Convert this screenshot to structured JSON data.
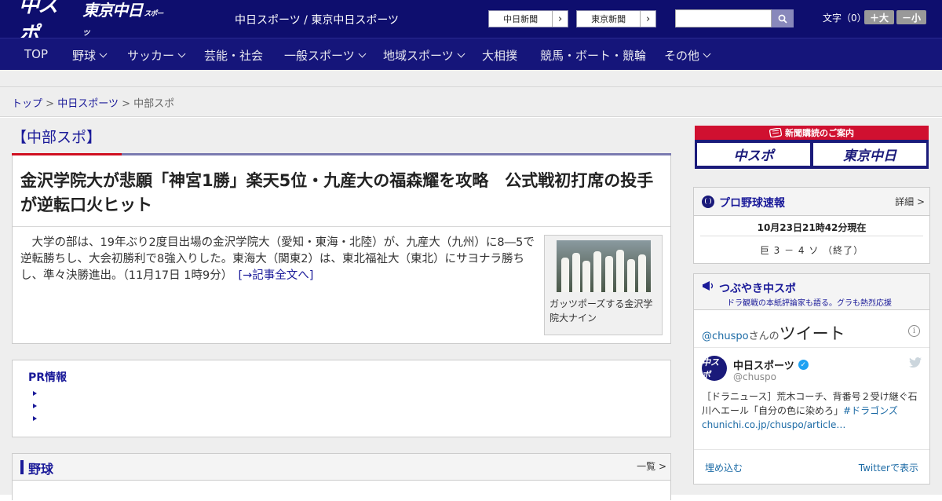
{
  "header": {
    "logo_primary": "中スポ",
    "logo_secondary": "東京中日",
    "logo_secondary_small": "スポーツ",
    "site_title": "中日スポーツ / 東京中日スポーツ",
    "newspaper_links": [
      {
        "label": "中日新聞",
        "arrow": "›"
      },
      {
        "label": "東京新聞",
        "arrow": "›"
      }
    ],
    "search": {
      "placeholder": "",
      "icon": "search-icon"
    },
    "font_size": {
      "label": "文字（0）",
      "increase": "＋大",
      "decrease": "－小"
    }
  },
  "nav": {
    "items": [
      {
        "label": "TOP",
        "dropdown": false
      },
      {
        "label": "野球",
        "dropdown": true
      },
      {
        "label": "サッカー",
        "dropdown": true
      },
      {
        "label": "芸能・社会",
        "dropdown": false
      },
      {
        "label": "一般スポーツ",
        "dropdown": true
      },
      {
        "label": "地域スポーツ",
        "dropdown": true
      },
      {
        "label": "大相撲",
        "dropdown": false
      },
      {
        "label": "競馬・ボート・競輪",
        "dropdown": false
      },
      {
        "label": "その他",
        "dropdown": true
      }
    ]
  },
  "breadcrumb": {
    "items": [
      "トップ",
      "中日スポーツ",
      "中部スポ"
    ],
    "separator": ">"
  },
  "main": {
    "category_title": "【中部スポ】",
    "article": {
      "headline": "金沢学院大が悲願「神宮1勝」楽天5位・九産大の福森耀を攻略　公式戦初打席の投手が逆転口火ヒット",
      "lead": "大学の部は、19年ぶり2度目出場の金沢学院大（愛知・東海・北陸）が、九産大（九州）に8―5で逆転勝ちし、大会初勝利で8強入りした。東海大（関東2）は、東北福祉大（東北）にサヨナラ勝ちし、準々決勝進出。（11月17日 1時9分）",
      "more_link": "[→記事全文へ]",
      "photo_caption": "ガッツポーズする金沢学院大ナイン"
    },
    "pr": {
      "title": "PR情報",
      "items": [
        "",
        "",
        ""
      ]
    },
    "baseball": {
      "title": "野球",
      "more": "一覧 >"
    }
  },
  "sidebar": {
    "subscribe": {
      "header": "新聞購読のご案内",
      "logos": [
        "中スポ",
        "東京中日"
      ]
    },
    "scores": {
      "title": "プロ野球速報",
      "more": "詳細 >",
      "timestamp": "10月23日21時42分現在",
      "games": [
        "巨 3 － 4 ソ （終了）"
      ]
    },
    "tweets": {
      "title": "つぶやき中スポ",
      "subtitle": "ドラ観戦の本紙評論家も語る。グラも熱烈応援",
      "widget_user": "@chuspo",
      "widget_suffix": "さんの",
      "widget_title": "ツイート",
      "info_icon": "i",
      "tweet": {
        "name": "中日スポーツ",
        "handle": "@chuspo",
        "avatar_text": "中スポ",
        "text_plain": "［ドラニュース］荒木コーチ、背番号２受け継ぐ石川へエール「自分の色に染めろ」",
        "hashtag": "#ドラゴンズ",
        "link": "chunichi.co.jp/chuspo/article…"
      },
      "embed": "埋め込む",
      "view_on": "Twitterで表示"
    }
  },
  "colors": {
    "brand_navy": "#0e0e6e",
    "link_blue": "#1a1a99",
    "accent_red": "#d01020",
    "twitter_blue": "#1b6aa5"
  }
}
